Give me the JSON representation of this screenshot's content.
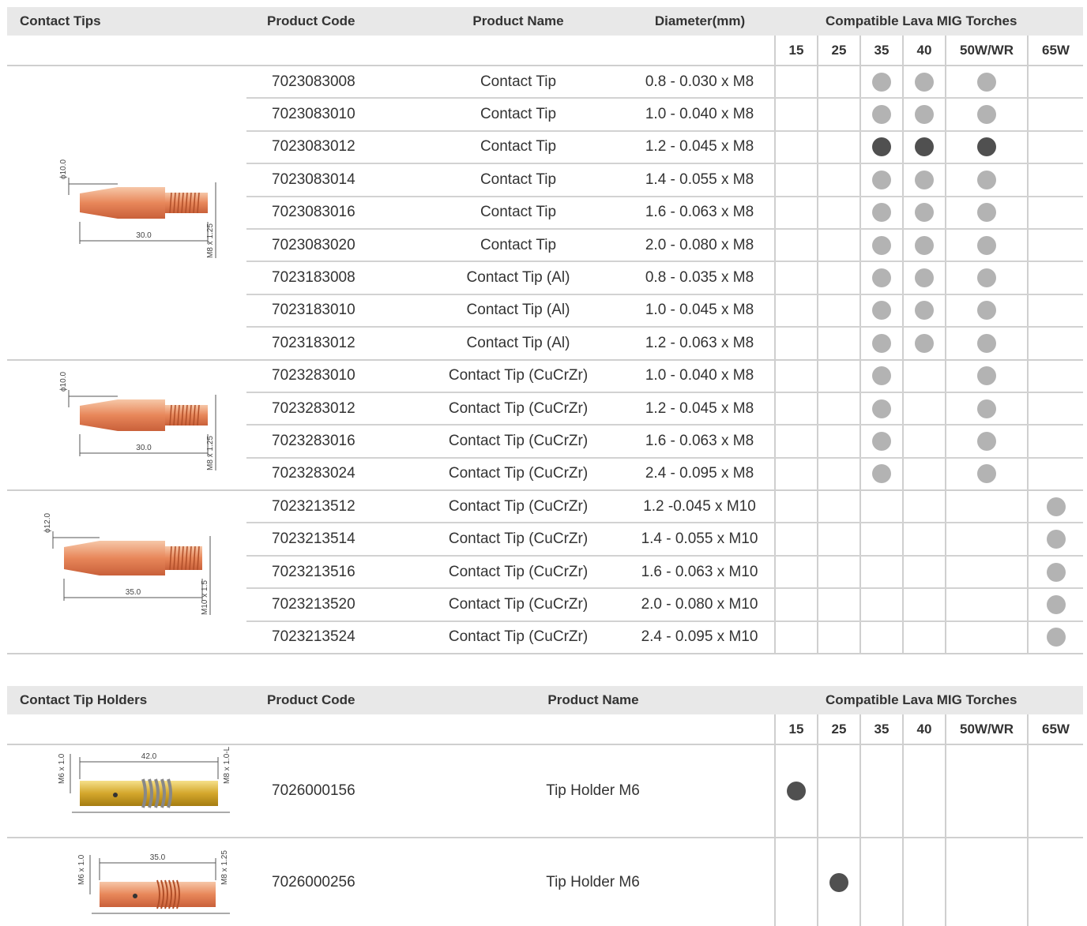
{
  "colors": {
    "header_bg": "#e8e8e8",
    "dot_light": "#b3b3b3",
    "dot_dark": "#505050",
    "copper": "#e8875a",
    "brass": "#d4a72c"
  },
  "tips_table": {
    "headers": {
      "category": "Contact Tips",
      "code": "Product Code",
      "name": "Product Name",
      "diameter": "Diameter(mm)",
      "compatible": "Compatible Lava MIG Torches"
    },
    "torches": [
      "15",
      "25",
      "35",
      "40",
      "50W/WR",
      "65W"
    ],
    "groups": [
      {
        "drawing": {
          "diameter": "ϕ10.0",
          "length": "30.0",
          "thread": "M8 x 1.25"
        },
        "rows": [
          {
            "code": "7023083008",
            "name": "Contact Tip",
            "diameter": "0.8 - 0.030 x M8",
            "compat": [
              "",
              "",
              "light",
              "light",
              "light",
              ""
            ]
          },
          {
            "code": "7023083010",
            "name": "Contact Tip",
            "diameter": "1.0 - 0.040 x M8",
            "compat": [
              "",
              "",
              "light",
              "light",
              "light",
              ""
            ]
          },
          {
            "code": "7023083012",
            "name": "Contact Tip",
            "diameter": "1.2 - 0.045 x M8",
            "compat": [
              "",
              "",
              "dark",
              "dark",
              "dark",
              ""
            ]
          },
          {
            "code": "7023083014",
            "name": "Contact Tip",
            "diameter": "1.4 - 0.055 x M8",
            "compat": [
              "",
              "",
              "light",
              "light",
              "light",
              ""
            ]
          },
          {
            "code": "7023083016",
            "name": "Contact Tip",
            "diameter": "1.6 - 0.063 x M8",
            "compat": [
              "",
              "",
              "light",
              "light",
              "light",
              ""
            ]
          },
          {
            "code": "7023083020",
            "name": "Contact Tip",
            "diameter": "2.0 - 0.080 x M8",
            "compat": [
              "",
              "",
              "light",
              "light",
              "light",
              ""
            ]
          },
          {
            "code": "7023183008",
            "name": "Contact Tip (Al)",
            "diameter": "0.8 - 0.035 x M8",
            "compat": [
              "",
              "",
              "light",
              "light",
              "light",
              ""
            ]
          },
          {
            "code": "7023183010",
            "name": "Contact Tip (Al)",
            "diameter": "1.0 - 0.045 x M8",
            "compat": [
              "",
              "",
              "light",
              "light",
              "light",
              ""
            ]
          },
          {
            "code": "7023183012",
            "name": "Contact Tip (Al)",
            "diameter": "1.2 - 0.063 x M8",
            "compat": [
              "",
              "",
              "light",
              "light",
              "light",
              ""
            ]
          }
        ]
      },
      {
        "drawing": {
          "diameter": "ϕ10.0",
          "length": "30.0",
          "thread": "M8 x 1.25"
        },
        "rows": [
          {
            "code": "7023283010",
            "name": "Contact Tip (CuCrZr)",
            "diameter": "1.0 - 0.040 x M8",
            "compat": [
              "",
              "",
              "light",
              "",
              "light",
              ""
            ]
          },
          {
            "code": "7023283012",
            "name": "Contact Tip (CuCrZr)",
            "diameter": "1.2 - 0.045 x M8",
            "compat": [
              "",
              "",
              "light",
              "",
              "light",
              ""
            ]
          },
          {
            "code": "7023283016",
            "name": "Contact Tip (CuCrZr)",
            "diameter": "1.6 - 0.063 x M8",
            "compat": [
              "",
              "",
              "light",
              "",
              "light",
              ""
            ]
          },
          {
            "code": "7023283024",
            "name": "Contact Tip (CuCrZr)",
            "diameter": "2.4 - 0.095 x M8",
            "compat": [
              "",
              "",
              "light",
              "",
              "light",
              ""
            ]
          }
        ]
      },
      {
        "drawing": {
          "diameter": "ϕ12.0",
          "length": "35.0",
          "thread": "M10 x 1.5"
        },
        "rows": [
          {
            "code": "7023213512",
            "name": "Contact Tip (CuCrZr)",
            "diameter": "1.2  -0.045 x M10",
            "compat": [
              "",
              "",
              "",
              "",
              "",
              "light"
            ]
          },
          {
            "code": "7023213514",
            "name": "Contact Tip (CuCrZr)",
            "diameter": "1.4 - 0.055 x M10",
            "compat": [
              "",
              "",
              "",
              "",
              "",
              "light"
            ]
          },
          {
            "code": "7023213516",
            "name": "Contact Tip (CuCrZr)",
            "diameter": "1.6 - 0.063 x M10",
            "compat": [
              "",
              "",
              "",
              "",
              "",
              "light"
            ]
          },
          {
            "code": "7023213520",
            "name": "Contact Tip (CuCrZr)",
            "diameter": "2.0 - 0.080 x M10",
            "compat": [
              "",
              "",
              "",
              "",
              "",
              "light"
            ]
          },
          {
            "code": "7023213524",
            "name": "Contact Tip (CuCrZr)",
            "diameter": "2.4 - 0.095 x M10",
            "compat": [
              "",
              "",
              "",
              "",
              "",
              "light"
            ]
          }
        ]
      }
    ]
  },
  "holders_table": {
    "headers": {
      "category": "Contact Tip Holders",
      "code": "Product Code",
      "name": "Product Name",
      "compatible": "Compatible Lava MIG Torches"
    },
    "torches": [
      "15",
      "25",
      "35",
      "40",
      "50W/WR",
      "65W"
    ],
    "rows": [
      {
        "drawing": {
          "left_thread": "M6 x 1.0",
          "length": "42.0",
          "right_thread": "M8 x 1.0-L"
        },
        "code": "7026000156",
        "name": "Tip Holder M6",
        "compat": [
          "dark",
          "",
          "",
          "",
          "",
          ""
        ]
      },
      {
        "drawing": {
          "left_thread": "M6 x 1.0",
          "length": "35.0",
          "right_thread": "M8 x 1.25"
        },
        "code": "7026000256",
        "name": "Tip Holder M6",
        "compat": [
          "",
          "dark",
          "",
          "",
          "",
          ""
        ]
      }
    ]
  }
}
